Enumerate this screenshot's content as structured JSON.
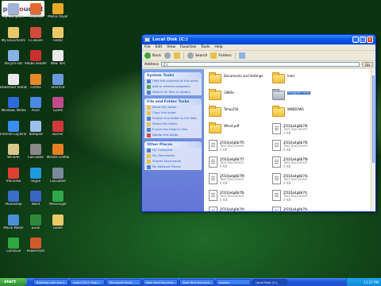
{
  "watermark": {
    "text": "ph",
    "accent": "oto",
    "suffix": "ucket"
  },
  "desktop": {
    "icons": [
      {
        "label": "My Computer",
        "color": "#9fb3d9"
      },
      {
        "label": "My Documents",
        "color": "#e8c968"
      },
      {
        "label": "Recycle Bin",
        "color": "#8bb2e6"
      },
      {
        "label": "Download Youtube",
        "color": "#e8e8e8"
      },
      {
        "label": "Windows Media",
        "color": "#2c6bd8"
      },
      {
        "label": "Internet Explorer",
        "color": "#3a8ef0"
      },
      {
        "label": "WinRAR",
        "color": "#d8c88a"
      },
      {
        "label": "IrfanView",
        "color": "#e04030"
      },
      {
        "label": "Photoshop",
        "color": "#3a70c8"
      },
      {
        "label": "Movie Maker",
        "color": "#4a90d8"
      },
      {
        "label": "Camtasia",
        "color": "#2ea840"
      },
      {
        "label": "Audacity",
        "color": "#e26a30"
      },
      {
        "label": "CCleaner",
        "color": "#d44a3a"
      },
      {
        "label": "Adobe Reader",
        "color": "#c83030"
      },
      {
        "label": "Firefox",
        "color": "#e68a2a"
      },
      {
        "label": "Paint",
        "color": "#4a8ae0"
      },
      {
        "label": "Notepad",
        "color": "#9ac0ea"
      },
      {
        "label": "Calculator",
        "color": "#8a8a8a"
      },
      {
        "label": "Skype",
        "color": "#1e9ae0"
      },
      {
        "label": "Word",
        "color": "#3a64c4"
      },
      {
        "label": "Excel",
        "color": "#2e8a3a"
      },
      {
        "label": "PowerPoint",
        "color": "#d05a2a"
      },
      {
        "label": "Media Player",
        "color": "#e6a92a"
      },
      {
        "label": "Folder",
        "color": "#e8c968"
      },
      {
        "label": "New Text",
        "color": "#eaeaea"
      },
      {
        "label": "Shortcut",
        "color": "#6a9ad8"
      },
      {
        "label": "Game",
        "color": "#c04a8a"
      },
      {
        "label": "Burner",
        "color": "#d03a3a"
      },
      {
        "label": "Mozilla Firefox",
        "color": "#e67e22"
      },
      {
        "label": "Calculator",
        "color": "#7a8a9a"
      },
      {
        "label": "Messenger",
        "color": "#2ea84a"
      },
      {
        "label": "Folder",
        "color": "#e8c968"
      }
    ]
  },
  "window": {
    "title": "Local Disk (C:)",
    "min": "_",
    "max": "□",
    "close": "x",
    "menu": [
      "File",
      "Edit",
      "View",
      "Favorites",
      "Tools",
      "Help"
    ],
    "toolbar": {
      "back": "Back",
      "search": "Search",
      "folders": "Folders"
    },
    "address_label": "Address",
    "address_value": "C:\\",
    "go": "Go",
    "tasks": [
      {
        "title": "System Tasks",
        "items": [
          {
            "label": "Hide the contents of this drive",
            "tone": "blue"
          },
          {
            "label": "Add or remove programs",
            "tone": "green"
          },
          {
            "label": "Search for files or folders",
            "tone": "blue"
          }
        ]
      },
      {
        "title": "File and Folder Tasks",
        "items": [
          {
            "label": "Move this folder",
            "tone": "yellow"
          },
          {
            "label": "Copy this folder",
            "tone": "yellow"
          },
          {
            "label": "Publish this folder to the Web",
            "tone": "blue"
          },
          {
            "label": "Share this folder",
            "tone": "yellow"
          },
          {
            "label": "E-mail this folder's files",
            "tone": "blue"
          },
          {
            "label": "Delete this folder",
            "tone": "red"
          }
        ]
      },
      {
        "title": "Other Places",
        "items": [
          {
            "label": "My Computer",
            "tone": "blue"
          },
          {
            "label": "My Documents",
            "tone": "yellow"
          },
          {
            "label": "Shared Documents",
            "tone": "yellow"
          },
          {
            "label": "My Network Places",
            "tone": "blue"
          }
        ]
      }
    ],
    "files": [
      {
        "kind": "folder",
        "name": "Documents and Settings"
      },
      {
        "kind": "folder",
        "name": "Intel"
      },
      {
        "kind": "none",
        "name": ""
      },
      {
        "kind": "folder",
        "name": "i386fa"
      },
      {
        "kind": "folder-gray",
        "name": "Program Files",
        "selected": true
      },
      {
        "kind": "none",
        "name": ""
      },
      {
        "kind": "folder",
        "name": "Temp256"
      },
      {
        "kind": "folder",
        "name": "WINDOWS"
      },
      {
        "kind": "none",
        "name": ""
      },
      {
        "kind": "folder",
        "name": "Whnd.pdf"
      },
      {
        "kind": "doc",
        "name": "2f316a4g8b7f4",
        "sub": "Text Document",
        "size": "0 KB"
      },
      {
        "kind": "none",
        "name": ""
      },
      {
        "kind": "doc",
        "name": "2f316a4g8b7f5",
        "sub": "Text Document",
        "size": "0 KB"
      },
      {
        "kind": "doc",
        "name": "2f316a4g8b7f6",
        "sub": "Text Document",
        "size": "0 KB"
      },
      {
        "kind": "none",
        "name": ""
      },
      {
        "kind": "doc",
        "name": "2f316a4g8b7f7",
        "sub": "Text Document",
        "size": "0 KB"
      },
      {
        "kind": "doc",
        "name": "2f316a4g8b7f8",
        "sub": "Text Document",
        "size": "0 KB"
      },
      {
        "kind": "none",
        "name": ""
      },
      {
        "kind": "doc",
        "name": "2f316a4g8b7f9",
        "sub": "Text Document",
        "size": "0 KB"
      },
      {
        "kind": "doc",
        "name": "2f316a4g8b7fa",
        "sub": "Text Document",
        "size": "0 KB"
      },
      {
        "kind": "none",
        "name": ""
      },
      {
        "kind": "doc",
        "name": "2f316a4g8b7fb",
        "sub": "Text Document",
        "size": "0 KB"
      },
      {
        "kind": "doc",
        "name": "2f316a4g8b7fc",
        "sub": "Text Document",
        "size": "0 KB"
      },
      {
        "kind": "none",
        "name": ""
      },
      {
        "kind": "doc",
        "name": "2f316a4g8b7fd",
        "sub": "Text Document",
        "size": "0 KB"
      },
      {
        "kind": "doc",
        "name": "2f316a4g8b7fe",
        "sub": "Text Document",
        "size": "0 KB"
      }
    ]
  },
  "taskbar": {
    "start": "start",
    "buttons": [
      {
        "label": "Building with the s..."
      },
      {
        "label": "notsci2011 Shan..."
      },
      {
        "label": "Microsoft Excel - ..."
      },
      {
        "label": "New Text Docume..."
      },
      {
        "label": "New Text Docume..."
      },
      {
        "label": "kasans"
      },
      {
        "label": "Local Disk (C:)",
        "active": true
      }
    ],
    "clock": "11:27 PM"
  },
  "colors": {
    "titlebar": "#0a5ae8",
    "taskbar": "#245edb",
    "selection": "#316ac5"
  }
}
